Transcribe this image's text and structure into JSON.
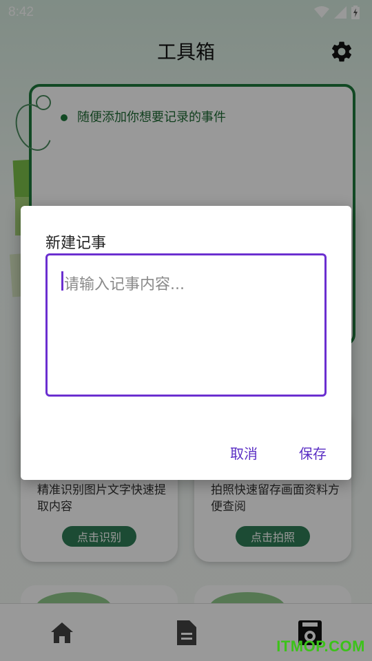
{
  "status_bar": {
    "time": "8:42",
    "icons": [
      "wifi-icon",
      "signal-icon",
      "battery-charging-icon"
    ]
  },
  "header": {
    "title": "工具箱",
    "settings_icon": "gear-icon"
  },
  "note_card": {
    "hint": "随便添加你想要记录的事件"
  },
  "tools": [
    {
      "description": "精准识别图片文字快速提取内容",
      "button_label": "点击识别"
    },
    {
      "description": "拍照快速留存画面资料方便查阅",
      "button_label": "点击拍照"
    }
  ],
  "bottom_nav": {
    "items": [
      {
        "icon": "home-icon"
      },
      {
        "icon": "document-icon"
      },
      {
        "icon": "notebook-icon",
        "active": true
      }
    ]
  },
  "dialog": {
    "title": "新建记事",
    "input_placeholder": "请输入记事内容...",
    "input_value": "",
    "cancel_label": "取消",
    "save_label": "保存"
  },
  "watermark": "ITMOP.COM",
  "colors": {
    "accent": "#6b2fd0",
    "button_text": "#5a2ec4",
    "brand_green": "#1f7a3d",
    "tool_button": "#2f7d57",
    "watermark": "#3cc21a"
  }
}
